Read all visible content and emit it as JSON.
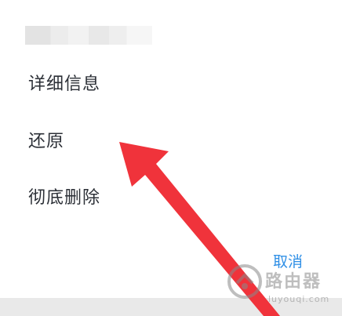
{
  "dialog": {
    "items": [
      {
        "label": "详细信息"
      },
      {
        "label": "还原"
      },
      {
        "label": "彻底删除"
      }
    ],
    "cancel_label": "取消"
  },
  "watermark": {
    "name": "路由器",
    "url": "luyouqi.com"
  },
  "colors": {
    "accent": "#2f8fe6",
    "arrow": "#f0333b",
    "text": "#2b2f36"
  }
}
